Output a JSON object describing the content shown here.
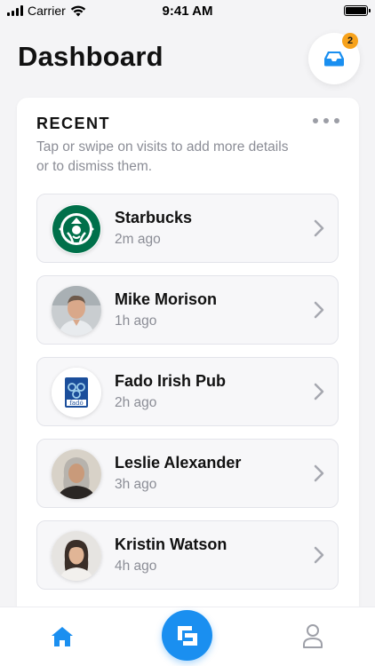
{
  "status_bar": {
    "carrier": "Carrier",
    "time": "9:41 AM"
  },
  "header": {
    "title": "Dashboard",
    "inbox_icon": "inbox-tray-icon",
    "badge_count": "2",
    "badge_color": "#f7a21b"
  },
  "recent": {
    "title": "RECENT",
    "subtitle": "Tap or swipe on visits to add more details or to dismiss them.",
    "more_icon": "more-horizontal-icon",
    "items": [
      {
        "name": "Starbucks",
        "time": "2m ago",
        "avatar": "starbucks-logo"
      },
      {
        "name": "Mike Morison",
        "time": "1h ago",
        "avatar": "person-photo"
      },
      {
        "name": "Fado Irish Pub",
        "time": "2h ago",
        "avatar": "fado-logo"
      },
      {
        "name": "Leslie Alexander",
        "time": "3h ago",
        "avatar": "person-photo"
      },
      {
        "name": "Kristin Watson",
        "time": "4h ago",
        "avatar": "person-photo"
      }
    ]
  },
  "tab_bar": {
    "active_tab": "home",
    "accent_color": "#1a8ff0",
    "icons": [
      "home-icon",
      "checkin-icon",
      "profile-icon"
    ]
  }
}
